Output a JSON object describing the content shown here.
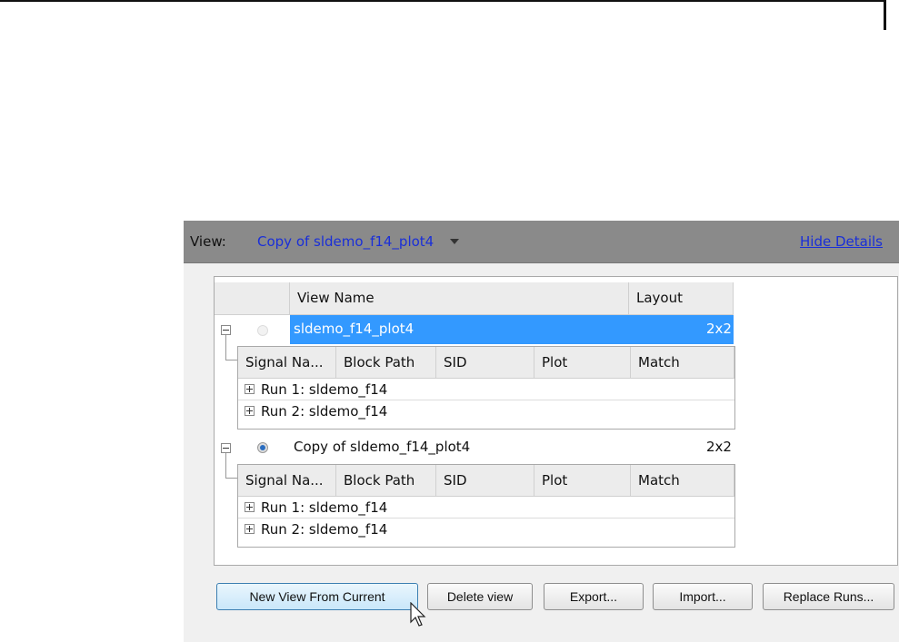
{
  "view_bar": {
    "label": "View:",
    "selected_view": "Copy of sldemo_f14_plot4",
    "hide_details": "Hide Details"
  },
  "views_table": {
    "columns": [
      "View Name",
      "Layout"
    ],
    "views": [
      {
        "name": "sldemo_f14_plot4",
        "layout": "2x2",
        "selected_row": true,
        "active": false,
        "signal_columns": [
          "Signal Na...",
          "Block Path",
          "SID",
          "Plot",
          "Match"
        ],
        "runs": [
          "Run 1: sldemo_f14",
          "Run 2: sldemo_f14"
        ]
      },
      {
        "name": "Copy of sldemo_f14_plot4",
        "layout": "2x2",
        "selected_row": false,
        "active": true,
        "signal_columns": [
          "Signal Na...",
          "Block Path",
          "SID",
          "Plot",
          "Match"
        ],
        "runs": [
          "Run 1: sldemo_f14",
          "Run 2: sldemo_f14"
        ]
      }
    ]
  },
  "buttons": {
    "new_view": "New View From Current",
    "delete_view": "Delete view",
    "export": "Export...",
    "import": "Import...",
    "replace_runs": "Replace Runs..."
  },
  "colors": {
    "selection": "#3399ff",
    "link": "#1a2fd8",
    "view_bar": "#8a8a8a"
  }
}
